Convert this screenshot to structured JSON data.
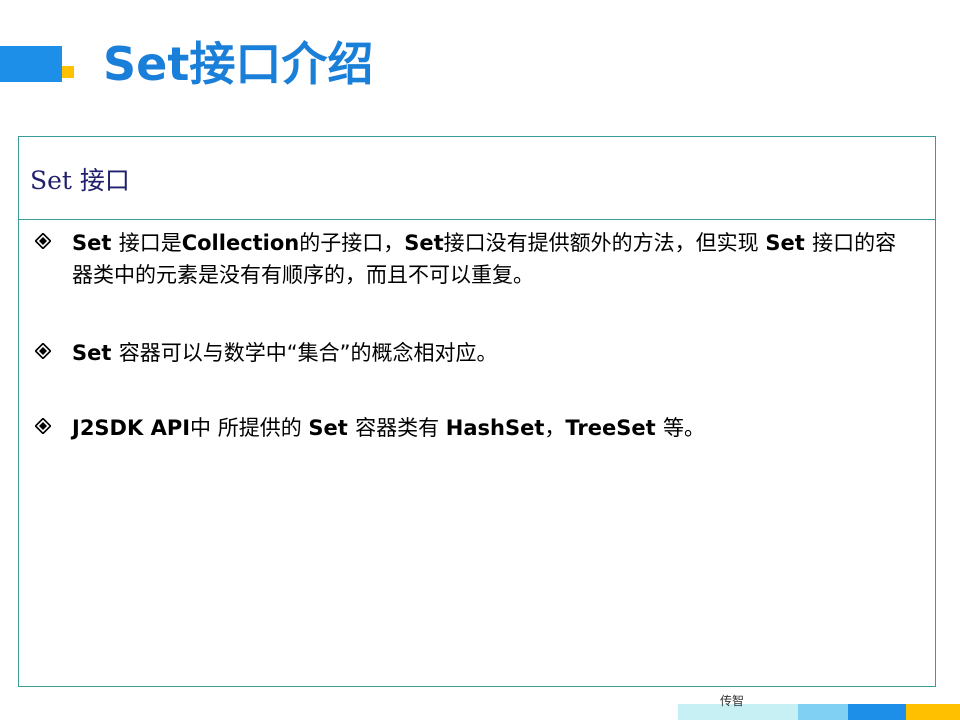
{
  "slide": {
    "title": "Set接口介绍",
    "box_header": "Set 接口",
    "bullets": [
      {
        "parts": [
          {
            "text": "Set ",
            "bold": true
          },
          {
            "text": "接口是",
            "bold": false
          },
          {
            "text": "Collection",
            "bold": true
          },
          {
            "text": "的子接口，",
            "bold": false
          },
          {
            "text": "Set",
            "bold": true
          },
          {
            "text": "接口没有提供额外的方法，但实现 ",
            "bold": false
          },
          {
            "text": "Set ",
            "bold": true
          },
          {
            "text": "接口的容器类中的元素是没有有顺序的，而且不可以重复。",
            "bold": false
          }
        ]
      },
      {
        "parts": [
          {
            "text": "Set ",
            "bold": true
          },
          {
            "text": "容器可以与数学中“集合”的概念相对应。",
            "bold": false
          }
        ]
      },
      {
        "parts": [
          {
            "text": "J2SDK API",
            "bold": true
          },
          {
            "text": "中 所提供的 ",
            "bold": false
          },
          {
            "text": "Set ",
            "bold": true
          },
          {
            "text": "容器类有 ",
            "bold": false
          },
          {
            "text": "HashSet",
            "bold": true
          },
          {
            "text": "，",
            "bold": false
          },
          {
            "text": "TreeSet ",
            "bold": true
          },
          {
            "text": "等。",
            "bold": false
          }
        ]
      }
    ],
    "footer": "传智",
    "colors": {
      "title": "#1a7fd8",
      "accent_blue": "#1e8fe8",
      "accent_yellow": "#ffc000",
      "box_border": "#3a9a9a",
      "header_text": "#1f1f6b"
    }
  }
}
